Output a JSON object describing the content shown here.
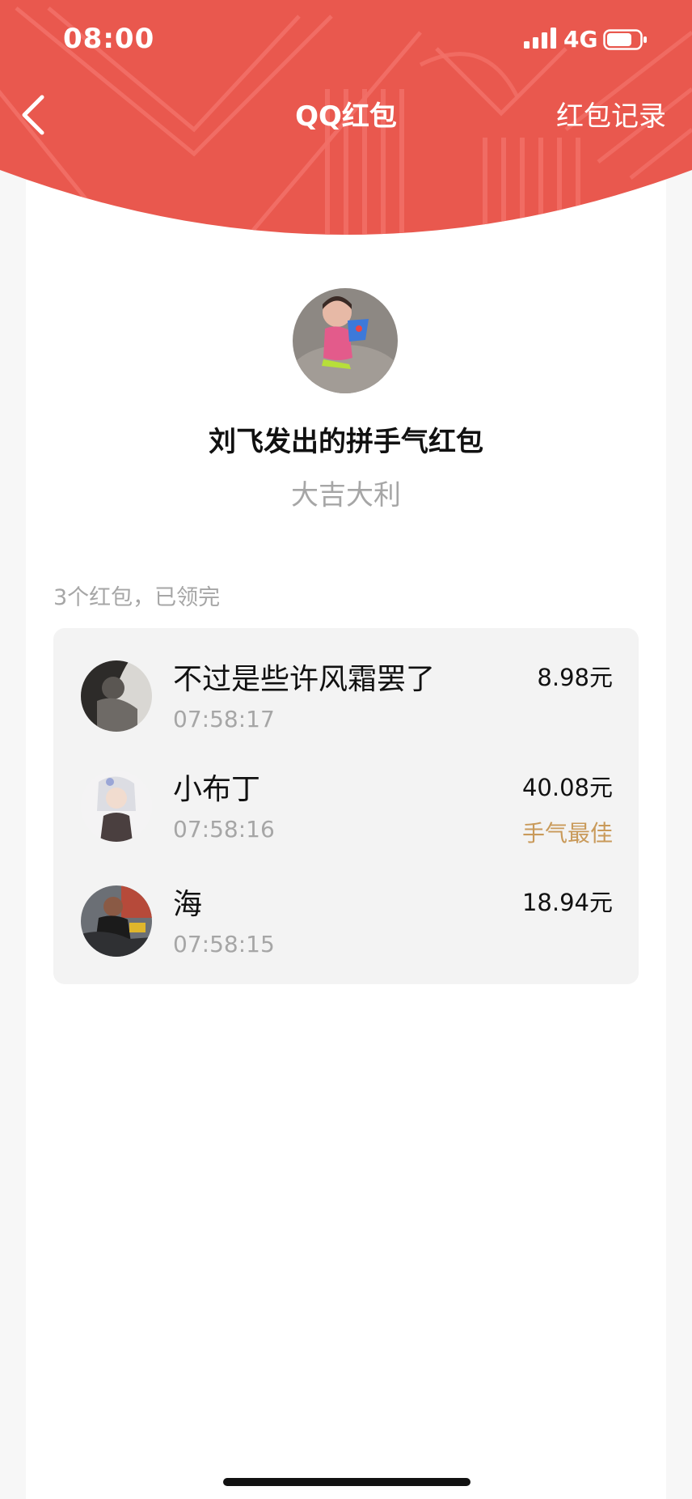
{
  "colors": {
    "header_red": "#e9584e",
    "pattern": "#f27068",
    "best_gold": "#c99a5a"
  },
  "status_bar": {
    "time": "08:00",
    "network": "4G",
    "signal_icon": "signal-bars-icon",
    "battery_icon": "battery-icon"
  },
  "nav": {
    "back_icon": "chevron-left-icon",
    "title": "QQ红包",
    "records": "红包记录"
  },
  "packet": {
    "sender_title": "刘飞发出的拼手气红包",
    "greeting": "大吉大利",
    "summary": "3个红包，已领完"
  },
  "recipients": [
    {
      "name": "不过是些许风霜罢了",
      "time": "07:58:17",
      "amount": "8.98元",
      "best": ""
    },
    {
      "name": "小布丁",
      "time": "07:58:16",
      "amount": "40.08元",
      "best": "手气最佳"
    },
    {
      "name": "海",
      "time": "07:58:15",
      "amount": "18.94元",
      "best": ""
    }
  ]
}
